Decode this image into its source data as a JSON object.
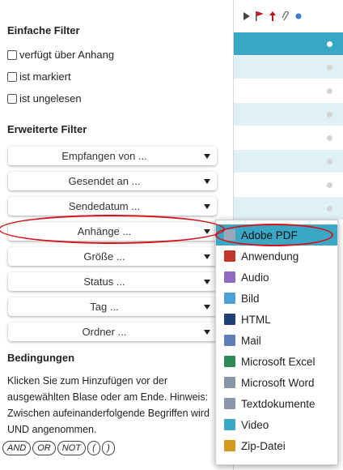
{
  "simple_filters": {
    "title": "Einfache Filter",
    "options": [
      {
        "label": "verfügt über Anhang"
      },
      {
        "label": "ist markiert"
      },
      {
        "label": "ist ungelesen"
      }
    ]
  },
  "advanced_filters": {
    "title": "Erweiterte Filter",
    "dropdowns": [
      {
        "label": "Empfangen von ..."
      },
      {
        "label": "Gesendet an ..."
      },
      {
        "label": "Sendedatum ..."
      },
      {
        "label": "Anhänge ..."
      },
      {
        "label": "Größe ..."
      },
      {
        "label": "Status ..."
      },
      {
        "label": "Tag ..."
      },
      {
        "label": "Ordner ..."
      }
    ]
  },
  "conditions": {
    "title": "Bedingungen",
    "hint": "Klicken Sie zum Hinzufügen vor der ausgewählten Blase oder am Ende. Hinweis: Zwischen aufeinanderfolgende Begriffen wird UND angenommen.",
    "operators": [
      "AND",
      "OR",
      "NOT",
      "(",
      ")"
    ]
  },
  "attachment_menu": {
    "items": [
      {
        "label": "Adobe PDF",
        "icon": "pdf-document-icon",
        "color": "#9aa7b8",
        "selected": true
      },
      {
        "label": "Anwendung",
        "icon": "application-gear-icon",
        "color": "#c0392b"
      },
      {
        "label": "Audio",
        "icon": "audio-note-icon",
        "color": "#8e6bc1"
      },
      {
        "label": "Bild",
        "icon": "image-icon",
        "color": "#4ca3d8"
      },
      {
        "label": "HTML",
        "icon": "html-code-icon",
        "color": "#1f3f7a"
      },
      {
        "label": "Mail",
        "icon": "mail-envelope-icon",
        "color": "#5f7fb8"
      },
      {
        "label": "Microsoft Excel",
        "icon": "excel-sheet-icon",
        "color": "#2e8b57"
      },
      {
        "label": "Microsoft Word",
        "icon": "word-document-icon",
        "color": "#8a97aa"
      },
      {
        "label": "Textdokumente",
        "icon": "text-document-icon",
        "color": "#8a97aa"
      },
      {
        "label": "Video",
        "icon": "video-icon",
        "color": "#3aa7c4"
      },
      {
        "label": "Zip-Datei",
        "icon": "zip-archive-icon",
        "color": "#d39a1b"
      }
    ]
  },
  "mail_list": {
    "header_icons": [
      "expand-arrow-icon",
      "flag-icon",
      "priority-arrow-icon",
      "attachment-clip-icon",
      "read-status-dot-icon"
    ],
    "rows": [
      {
        "style": "selected"
      },
      {
        "style": "blue"
      },
      {
        "style": "white"
      },
      {
        "style": "blue"
      },
      {
        "style": "white"
      },
      {
        "style": "blue"
      },
      {
        "style": "white"
      },
      {
        "style": "blue"
      },
      {
        "style": "white"
      }
    ]
  },
  "colors": {
    "accent": "#3aa7c4",
    "row_alt": "#e0f1f6",
    "annotation_red": "#d4141c"
  }
}
